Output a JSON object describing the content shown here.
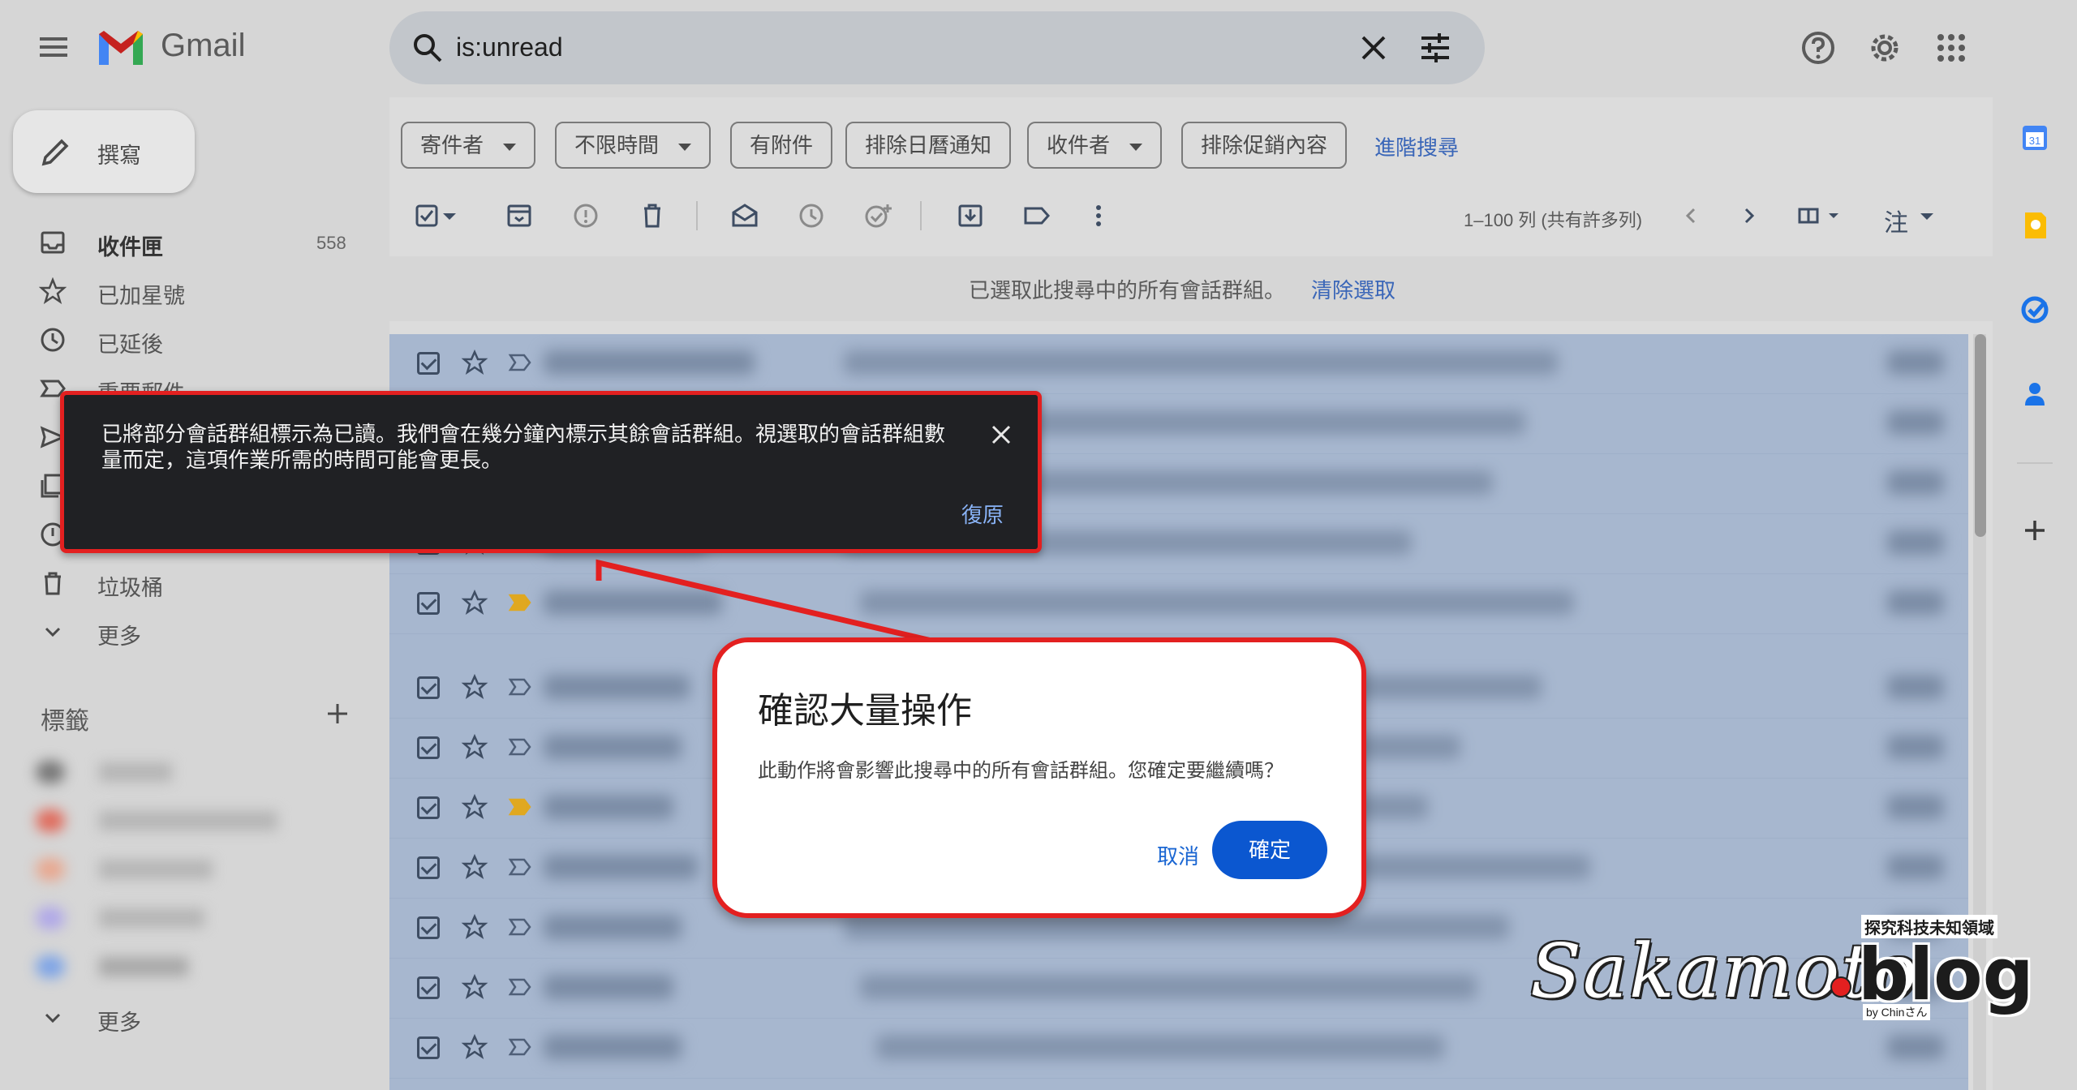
{
  "app": {
    "name": "Gmail",
    "search_query": "is:unread"
  },
  "compose_label": "撰寫",
  "nav": [
    {
      "label": "收件匣",
      "count": "558",
      "icon": "inbox-icon"
    },
    {
      "label": "已加星號",
      "icon": "star-icon"
    },
    {
      "label": "已延後",
      "icon": "clock-icon"
    },
    {
      "label": "重要郵件",
      "icon": "important-icon"
    },
    {
      "label": "垃圾桶",
      "icon": "trash-icon"
    },
    {
      "label": "更多",
      "icon": "chevron-down-icon"
    }
  ],
  "labels_section": {
    "title": "標籤",
    "more": "更多"
  },
  "filter_chips": [
    {
      "label": "寄件者",
      "dropdown": true
    },
    {
      "label": "不限時間",
      "dropdown": true
    },
    {
      "label": "有附件",
      "dropdown": false
    },
    {
      "label": "排除日曆通知",
      "dropdown": false
    },
    {
      "label": "收件者",
      "dropdown": true
    },
    {
      "label": "排除促銷內容",
      "dropdown": false
    }
  ],
  "advanced_search": "進階搜尋",
  "pager": {
    "range_text": "1–100 列 (共有許多列)"
  },
  "density_label": "注",
  "selection_banner": {
    "text": "已選取此搜尋中的所有會話群組。",
    "clear_link": "清除選取"
  },
  "snackbar": {
    "message": "已將部分會話群組標示為已讀。我們會在幾分鐘內標示其餘會話群組。視選取的會話群組數量而定，這項作業所需的時間可能會更長。",
    "undo": "復原"
  },
  "dialog": {
    "title": "確認大量操作",
    "body": "此動作將會影響此搜尋中的所有會話群組。您確定要繼續嗎？",
    "cancel": "取消",
    "confirm": "確定"
  },
  "watermark": {
    "script": "Sakamoto",
    "blog": "blog",
    "tagline": "探究科技未知領域",
    "by": "by Chinさん"
  },
  "colors": {
    "accent_blue": "#0b57d0",
    "highlight_red": "#e32020",
    "selected_rows": "#a7b7cf",
    "snackbar_bg": "#202124",
    "important_marker": "#e0a820"
  }
}
